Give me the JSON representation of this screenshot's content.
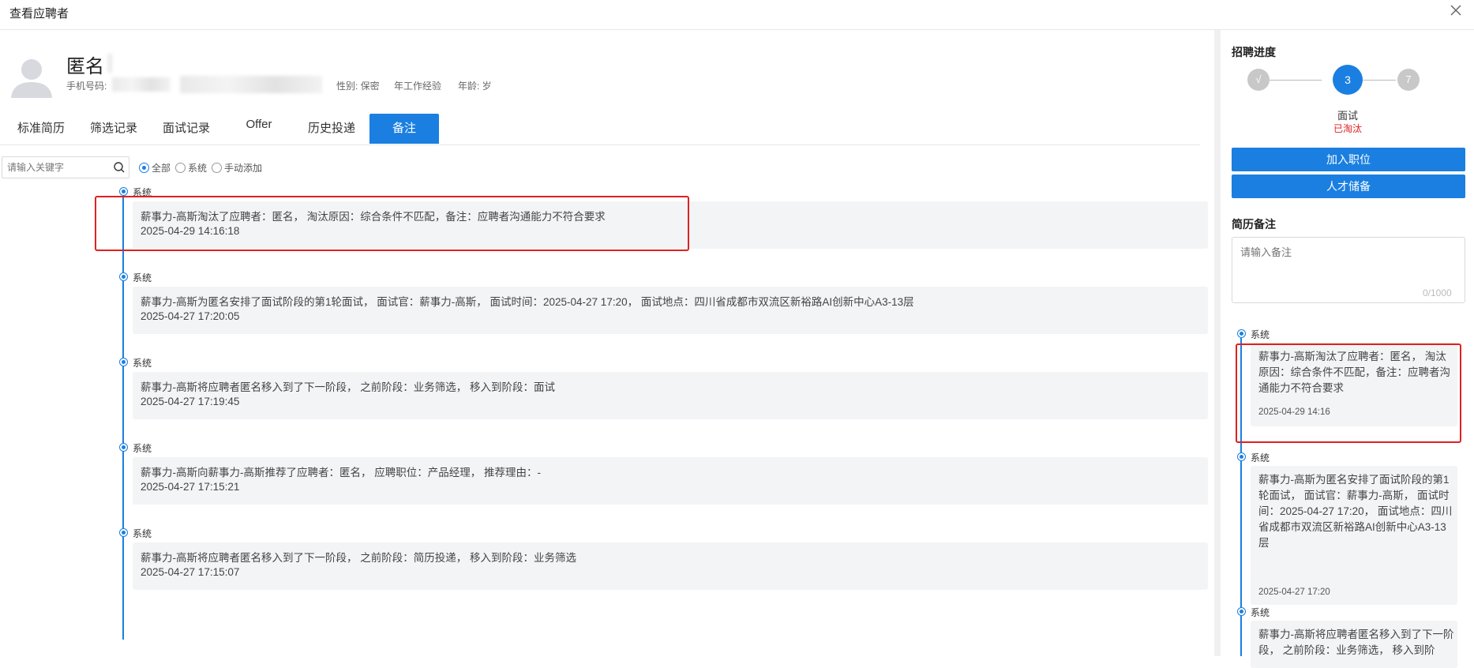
{
  "window": {
    "title": "查看应聘者"
  },
  "candidate": {
    "name": "匿名",
    "phone_label": "手机号码:",
    "gender": "性别: 保密",
    "experience": "年工作经验",
    "age": "年龄: 岁"
  },
  "tabs": [
    {
      "label": "标准简历",
      "active": false
    },
    {
      "label": "筛选记录",
      "active": false
    },
    {
      "label": "面试记录",
      "active": false
    },
    {
      "label": "Offer",
      "active": false
    },
    {
      "label": "历史投递",
      "active": false
    },
    {
      "label": "备注",
      "active": true
    }
  ],
  "filter": {
    "search_placeholder": "请输入关键字",
    "options": [
      {
        "label": "全部",
        "checked": true
      },
      {
        "label": "系统",
        "checked": false
      },
      {
        "label": "手动添加",
        "checked": false
      }
    ]
  },
  "timeline": [
    {
      "source": "系统",
      "text": "薪事力-高斯淘汰了应聘者：匿名， 淘汰原因：综合条件不匹配，备注：应聘者沟通能力不符合要求",
      "time": "2025-04-29 14:16:18",
      "highlighted": true
    },
    {
      "source": "系统",
      "text": "薪事力-高斯为匿名安排了面试阶段的第1轮面试， 面试官：薪事力-高斯， 面试时间：2025-04-27 17:20， 面试地点：四川省成都市双流区新裕路AI创新中心A3-13层",
      "time": "2025-04-27 17:20:05",
      "highlighted": false
    },
    {
      "source": "系统",
      "text": "薪事力-高斯将应聘者匿名移入到了下一阶段， 之前阶段：业务筛选， 移入到阶段：面试",
      "time": "2025-04-27 17:19:45",
      "highlighted": false
    },
    {
      "source": "系统",
      "text": "薪事力-高斯向薪事力-高斯推荐了应聘者：匿名， 应聘职位：产品经理， 推荐理由：-",
      "time": "2025-04-27 17:15:21",
      "highlighted": false
    },
    {
      "source": "系统",
      "text": "薪事力-高斯将应聘者匿名移入到了下一阶段， 之前阶段：简历投递， 移入到阶段：业务筛选",
      "time": "2025-04-27 17:15:07",
      "highlighted": false
    }
  ],
  "progress": {
    "title": "招聘进度",
    "steps": [
      {
        "label": "√"
      },
      {
        "label": "3"
      },
      {
        "label": "7"
      }
    ],
    "current_stage": "面试",
    "current_status": "已淘汰"
  },
  "actions": {
    "add_position": "加入职位",
    "talent_reserve": "人才储备"
  },
  "resume_note": {
    "title": "简历备注",
    "placeholder": "请输入备注",
    "counter": "0/1000"
  },
  "side_timeline": [
    {
      "source": "系统",
      "text": "薪事力-高斯淘汰了应聘者：匿名， 淘汰原因：综合条件不匹配，备注：应聘者沟通能力不符合要求",
      "time": "2025-04-29 14:16",
      "highlighted": true
    },
    {
      "source": "系统",
      "text": "薪事力-高斯为匿名安排了面试阶段的第1轮面试， 面试官：薪事力-高斯， 面试时间：2025-04-27 17:20， 面试地点：四川省成都市双流区新裕路AI创新中心A3-13层",
      "time": "2025-04-27 17:20",
      "highlighted": false
    },
    {
      "source": "系统",
      "text": "薪事力-高斯将应聘者匿名移入到了下一阶段， 之前阶段：业务筛选， 移入到阶",
      "time": "",
      "highlighted": false
    }
  ],
  "colors": {
    "accent": "#1a7fe0",
    "danger": "#e02020",
    "card_bg": "#f3f4f6"
  }
}
